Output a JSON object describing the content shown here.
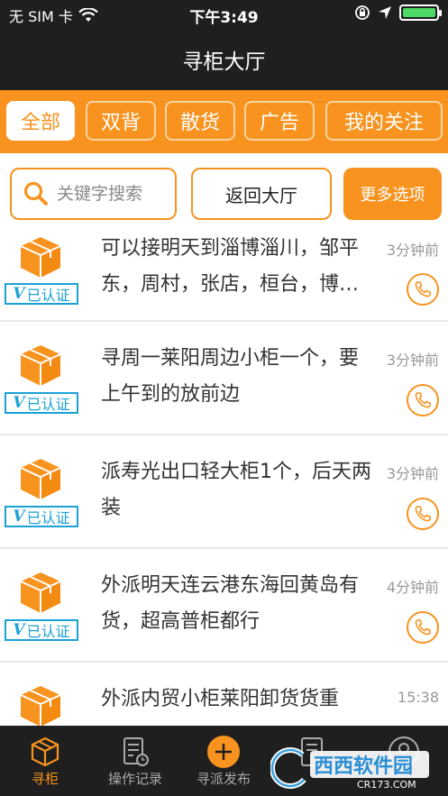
{
  "status_bar": {
    "carrier": "无 SIM 卡",
    "time": "下午3:49",
    "battery_level": 1.0
  },
  "header": {
    "title": "寻柜大厅"
  },
  "tabs": [
    {
      "label": "全部",
      "active": true
    },
    {
      "label": "双背",
      "active": false
    },
    {
      "label": "散货",
      "active": false
    },
    {
      "label": "广告",
      "active": false
    },
    {
      "label": "我的关注",
      "active": false
    }
  ],
  "search": {
    "placeholder": "关键字搜索",
    "value": "",
    "back_label": "返回大厅",
    "more_label": "更多选项"
  },
  "listings": [
    {
      "text": "可以接明天到淄博淄川，邹平东，周村，张店，桓台，博山，沂源，沂水",
      "time": "3分钟前",
      "verified": true,
      "verified_label": "已认证",
      "verified_mark": "V"
    },
    {
      "text": "寻周一莱阳周边小柜一个，要上午到的放前边",
      "time": "3分钟前",
      "verified": true,
      "verified_label": "已认证",
      "verified_mark": "V"
    },
    {
      "text": "派寿光出口轻大柜1个，后天两装",
      "time": "3分钟前",
      "verified": true,
      "verified_label": "已认证",
      "verified_mark": "V"
    },
    {
      "text": "外派明天连云港东海回黄岛有货，超高普柜都行",
      "time": "4分钟前",
      "verified": true,
      "verified_label": "已认证",
      "verified_mark": "V"
    },
    {
      "text": "外派内贸小柜莱阳卸货货重",
      "time": "15:38",
      "verified": false,
      "verified_label": "",
      "verified_mark": ""
    }
  ],
  "bottom_nav": [
    {
      "label": "寻柜",
      "icon": "box-icon",
      "active": true
    },
    {
      "label": "操作记录",
      "icon": "records-icon",
      "active": false
    },
    {
      "label": "寻派发布",
      "icon": "plus-circle-icon",
      "active": false
    },
    {
      "label": "",
      "icon": "document-icon",
      "active": false
    },
    {
      "label": "",
      "icon": "user-icon",
      "active": false
    }
  ],
  "watermark": {
    "brand": "西西软件园",
    "domain": "CR173.COM"
  },
  "colors": {
    "accent": "#f7931e",
    "dark_bar": "#1f1f1f",
    "verified_blue": "#1aa1d6",
    "battery_green": "#4cd964"
  }
}
